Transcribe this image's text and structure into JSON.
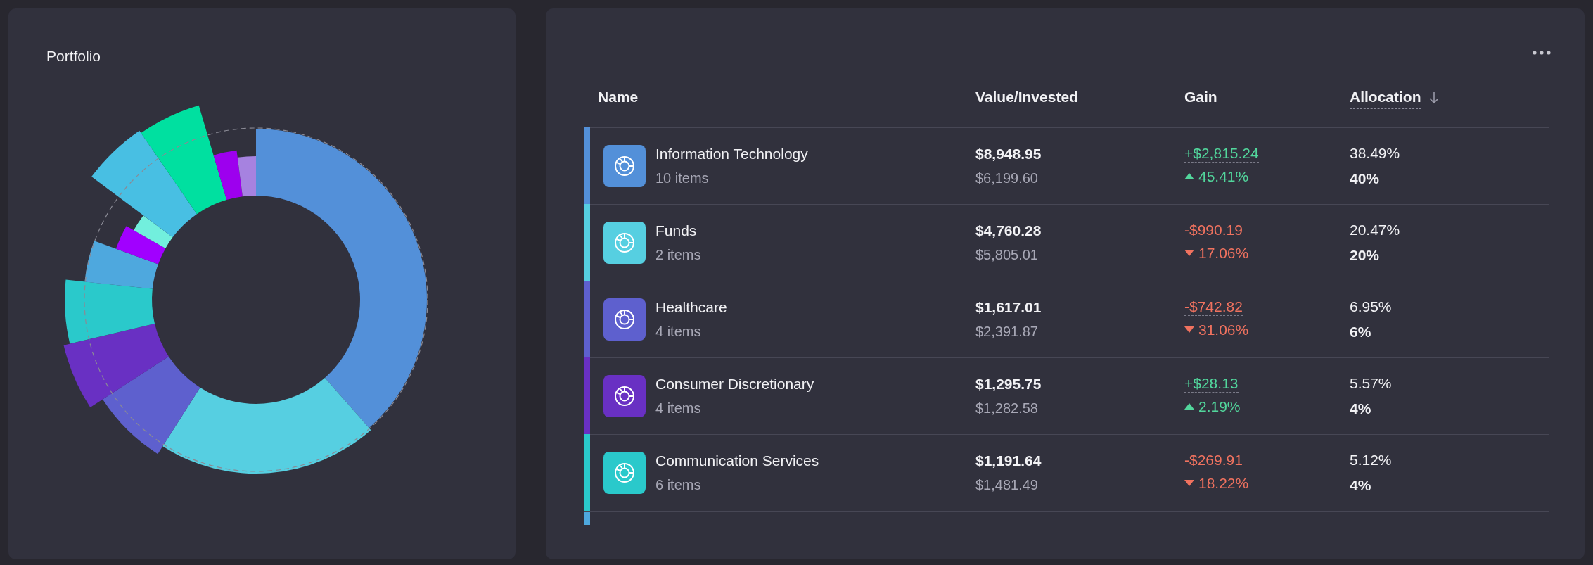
{
  "portfolio": {
    "title": "Portfolio"
  },
  "table": {
    "columns": [
      {
        "label": "Name",
        "sorted": false
      },
      {
        "label": "Value/Invested",
        "sorted": false
      },
      {
        "label": "Gain",
        "sorted": false
      },
      {
        "label": "Allocation",
        "sorted": true
      }
    ],
    "rows": [
      {
        "name": "Information Technology",
        "items": "10 items",
        "color": "#5390d9",
        "value": "$8,948.95",
        "invested": "$6,199.60",
        "gain": "+$2,815.24",
        "rising": true,
        "gain_pct": "45.41%",
        "allocation": "38.49%",
        "target": "40%"
      },
      {
        "name": "Funds",
        "items": "2 items",
        "color": "#56cfe1",
        "value": "$4,760.28",
        "invested": "$5,805.01",
        "gain": "-$990.19",
        "rising": false,
        "gain_pct": "17.06%",
        "allocation": "20.47%",
        "target": "20%"
      },
      {
        "name": "Healthcare",
        "items": "4 items",
        "color": "#5e60ce",
        "value": "$1,617.01",
        "invested": "$2,391.87",
        "gain": "-$742.82",
        "rising": false,
        "gain_pct": "31.06%",
        "allocation": "6.95%",
        "target": "6%"
      },
      {
        "name": "Consumer Discretionary",
        "items": "4 items",
        "color": "#6930c3",
        "value": "$1,295.75",
        "invested": "$1,282.58",
        "gain": "+$28.13",
        "rising": true,
        "gain_pct": "2.19%",
        "allocation": "5.57%",
        "target": "4%"
      },
      {
        "name": "Communication Services",
        "items": "6 items",
        "color": "#2ac9cb",
        "value": "$1,191.64",
        "invested": "$1,481.49",
        "gain": "-$269.91",
        "rising": false,
        "gain_pct": "18.22%",
        "allocation": "5.12%",
        "target": "4%"
      }
    ],
    "partial_row": {
      "color": "#4ea8de"
    }
  }
}
